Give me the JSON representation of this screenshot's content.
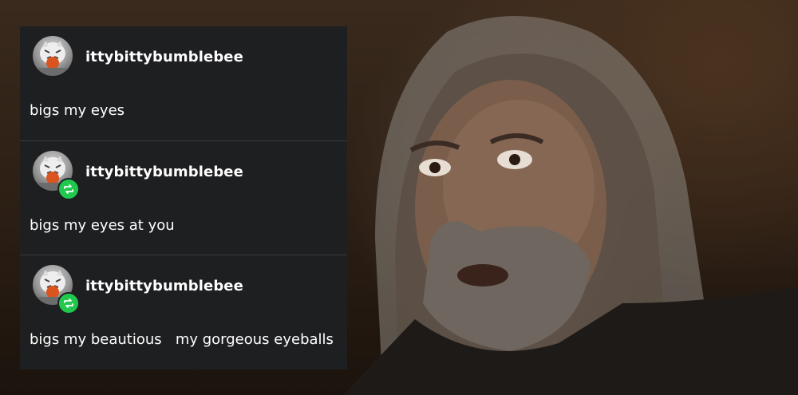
{
  "posts": [
    {
      "username": "ittybittybumblebee",
      "text": "bigs my eyes",
      "reblog": false
    },
    {
      "username": "ittybittybumblebee",
      "text": "bigs my eyes at you",
      "reblog": true
    },
    {
      "username": "ittybittybumblebee",
      "text": "bigs my beautious   my gorgeous eyeballs",
      "reblog": true
    }
  ],
  "colors": {
    "panel_bg": "#1e1f21",
    "reblog_badge": "#20c94e",
    "text": "#ffffff"
  },
  "icons": {
    "avatar": "white-tiger-avatar-icon",
    "badge": "reblog-icon"
  }
}
